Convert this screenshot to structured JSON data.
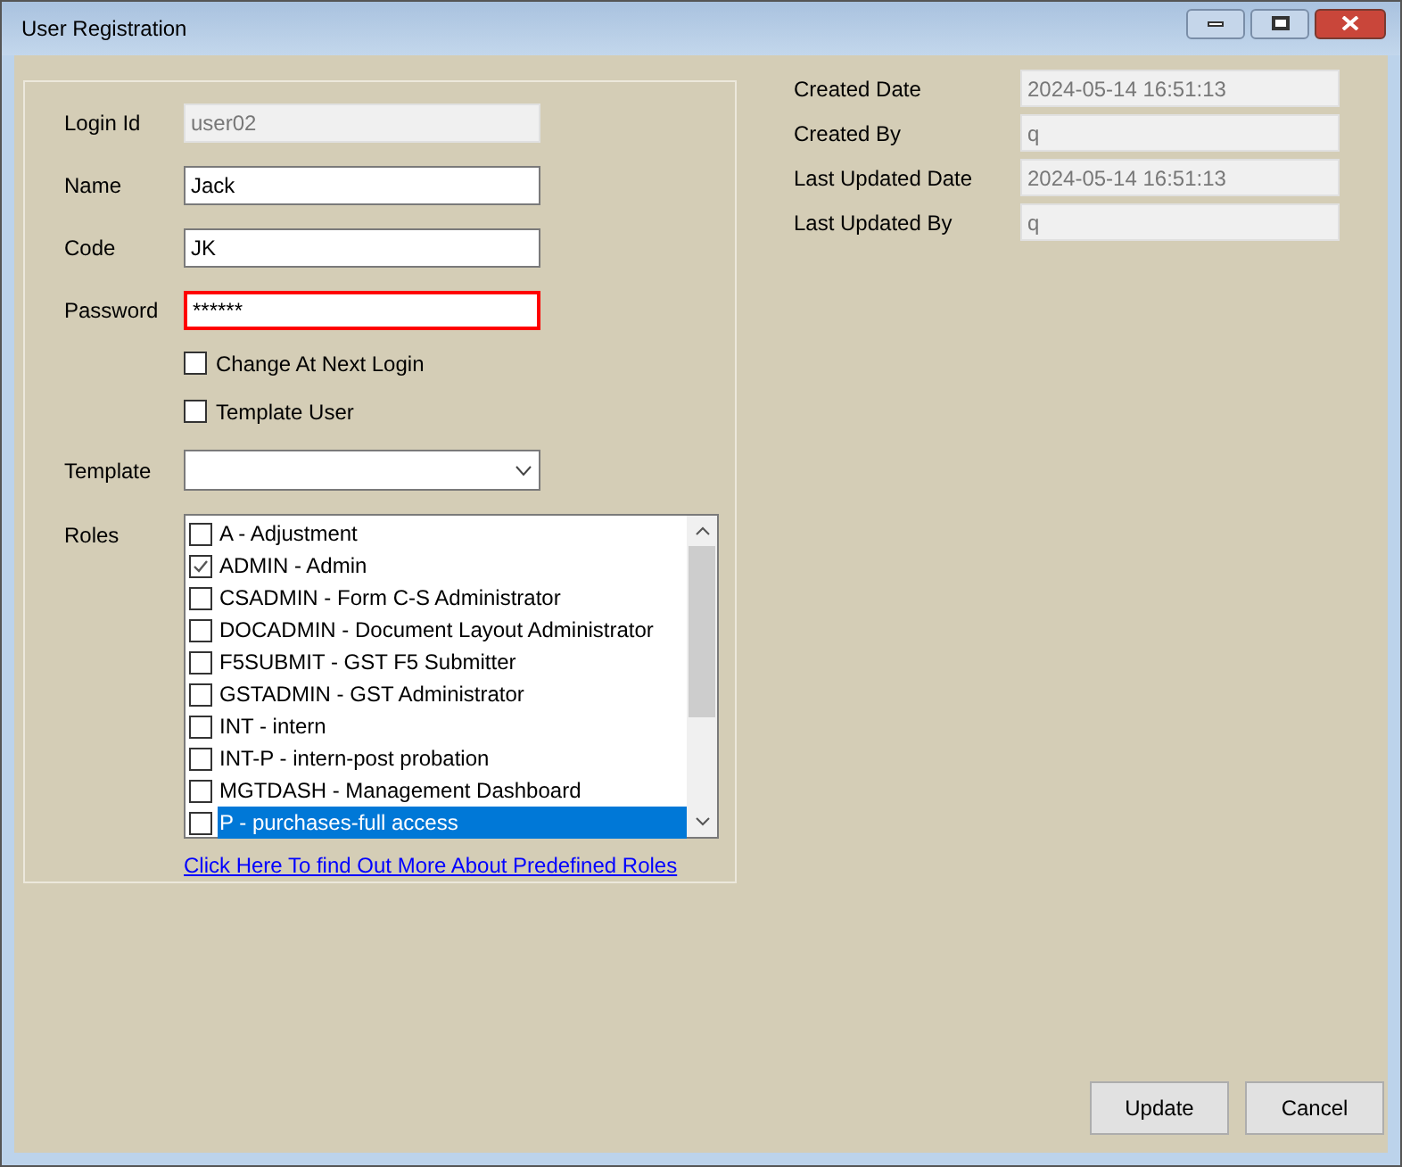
{
  "window": {
    "title": "User Registration"
  },
  "fields": [
    {
      "label": "Login Id",
      "value": "user02",
      "disabled": true,
      "focused": false
    },
    {
      "label": "Name",
      "value": "Jack",
      "disabled": false,
      "focused": false
    },
    {
      "label": "Code",
      "value": "JK",
      "disabled": false,
      "focused": false
    },
    {
      "label": "Password",
      "value": "******",
      "disabled": false,
      "focused": true
    }
  ],
  "options": [
    {
      "label": "Change At Next Login",
      "checked": false
    },
    {
      "label": "Template User",
      "checked": false
    }
  ],
  "template": {
    "label": "Template"
  },
  "roles": {
    "label": "Roles",
    "items": [
      {
        "label": "A - Adjustment",
        "checked": false,
        "selected": false
      },
      {
        "label": "ADMIN - Admin",
        "checked": true,
        "selected": false
      },
      {
        "label": "CSADMIN - Form C-S Administrator",
        "checked": false,
        "selected": false
      },
      {
        "label": "DOCADMIN - Document Layout Administrator",
        "checked": false,
        "selected": false
      },
      {
        "label": "F5SUBMIT - GST F5 Submitter",
        "checked": false,
        "selected": false
      },
      {
        "label": "GSTADMIN - GST Administrator",
        "checked": false,
        "selected": false
      },
      {
        "label": "INT - intern",
        "checked": false,
        "selected": false
      },
      {
        "label": "INT-P - intern-post probation",
        "checked": false,
        "selected": false
      },
      {
        "label": "MGTDASH - Management Dashboard",
        "checked": false,
        "selected": false
      },
      {
        "label": "P - purchases-full access",
        "checked": false,
        "selected": true
      }
    ],
    "link": "Click Here To find Out More About Predefined Roles"
  },
  "audit": [
    {
      "label": "Created Date",
      "value": "2024-05-14 16:51:13"
    },
    {
      "label": "Created By",
      "value": "q"
    },
    {
      "label": "Last Updated Date",
      "value": "2024-05-14 16:51:13"
    },
    {
      "label": "Last Updated By",
      "value": "q"
    }
  ],
  "buttons": [
    {
      "label": "Update"
    },
    {
      "label": "Cancel"
    }
  ]
}
